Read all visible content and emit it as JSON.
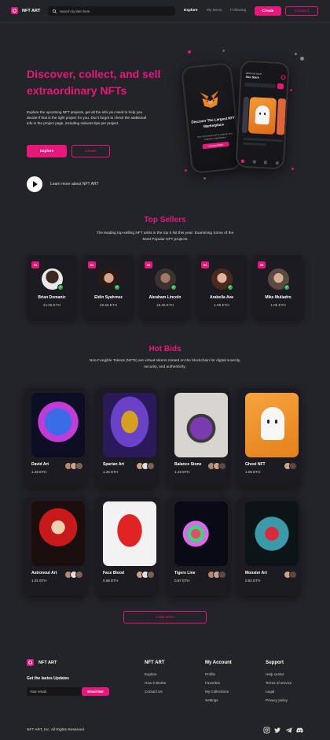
{
  "header": {
    "brand": "NFT ART",
    "search_placeholder": "Search by item here",
    "nav": [
      "Explore",
      "My Items",
      "Following"
    ],
    "create_label": "Create",
    "connect_label": "Connect"
  },
  "hero": {
    "title": "Discover, collect, and sell extraordinary NFTs",
    "text": "Explore the upcoming NFT projects, get all the info you need to help you decide if that is the right project for you. Don't forget to check the additional info in the project page, including relevant tips per project.",
    "explore_label": "Explore",
    "create_label": "Create",
    "learn_label": "Learn more about NFT ART",
    "phone_left": {
      "title": "Discover The Largest NFT Marketplace",
      "text": "Your first Intuitive NFTs explorer and collection marketplace",
      "button": "Connect Wallet"
    },
    "phone_right": {
      "greeting": "Welcome back!",
      "name": "Alex Stark"
    }
  },
  "top_sellers": {
    "title": "Top Sellers",
    "subtitle": "The leading top-selling NFT artist in the top 5 list this year: Examining Some of the Most Popular NFT projects",
    "sellers": [
      {
        "rank": "01",
        "name": "Brian Domanic",
        "price": "21.05 ETH"
      },
      {
        "rank": "02",
        "name": "Eldin Syahrnez",
        "price": "20.65 ETH"
      },
      {
        "rank": "03",
        "name": "Abraham Lincoln",
        "price": "18.35 ETH"
      },
      {
        "rank": "04",
        "name": "Arabella Ava",
        "price": "1.05 ETH"
      },
      {
        "rank": "05",
        "name": "Mike Muliadro",
        "price": "1.05 ETH"
      }
    ]
  },
  "hot_bids": {
    "title": "Hot Bids",
    "subtitle": "Non-Fungible Tokens (NFTs) are virtual tokens minted on the blockchain for digital scarcity, security, and authenticity.",
    "items": [
      {
        "name": "David Art",
        "price": "1.25 ETH"
      },
      {
        "name": "Spartan Art",
        "price": "1.25 ETH"
      },
      {
        "name": "Balance Stone",
        "price": "1.23 ETH"
      },
      {
        "name": "Ghost NFT",
        "price": "1.05 ETH"
      },
      {
        "name": "Astronout Art",
        "price": "1.01 ETH"
      },
      {
        "name": "Face Blood",
        "price": "0.98 ETH"
      },
      {
        "name": "Tigers Line",
        "price": "0.87 ETH"
      },
      {
        "name": "Monster Art",
        "price": "0.82 ETH"
      }
    ],
    "load_more_label": "Load More"
  },
  "footer": {
    "brand": "NFT ART",
    "updates_label": "Get the lastes Updates",
    "email_placeholder": "Your email",
    "email_button": "Email Me!",
    "columns": [
      {
        "title": "NFT ART",
        "links": [
          "Explore",
          "How it Works",
          "Contact Us"
        ]
      },
      {
        "title": "My Account",
        "links": [
          "Profile",
          "Favorites",
          "My Collections",
          "Settings"
        ]
      },
      {
        "title": "Support",
        "links": [
          "Help center",
          "Terms of service",
          "Legal",
          "Privacy policy"
        ]
      }
    ],
    "copyright": "NFT ART, Inc. All Rights Reserved",
    "socials": [
      "instagram-icon",
      "twitter-icon",
      "telegram-icon",
      "discord-icon"
    ]
  },
  "colors": {
    "accent": "#e6197a",
    "background": "#23232a",
    "card": "#1b1b21"
  }
}
